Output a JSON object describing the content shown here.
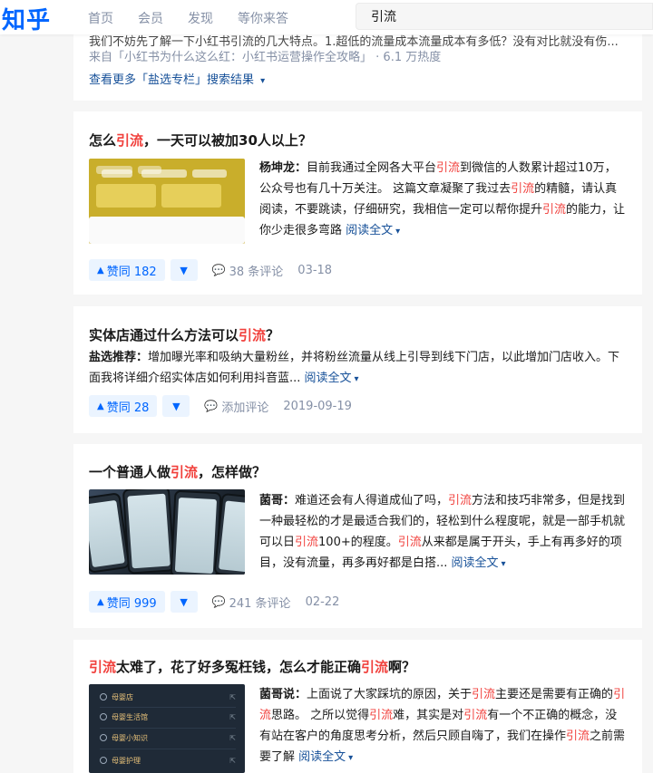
{
  "header": {
    "logo": "知乎",
    "nav": [
      "首页",
      "会员",
      "发现",
      "等你来答"
    ],
    "search_value": "引流"
  },
  "colors": {
    "brand": "#0066ff",
    "highlight": "#f1403c",
    "link": "#175199",
    "meta": "#8590a6"
  },
  "top_card": {
    "snippet": "我们不妨先了解一下小红书引流的几大特点。1.超低的流量成本流量成本有多低？没有对比就没有伤...",
    "source_prefix": "来自「小红书为什么这么红：小红书运营操作全攻略」",
    "source_heat": "· 6.1 万热度",
    "more": "查看更多「盐选专栏」搜索结果"
  },
  "results": [
    {
      "title": [
        "怎么",
        "引流",
        "，一天可以被加30人以上？"
      ],
      "author": "杨坤龙：",
      "excerpt": [
        "目前我通过全网各大平台",
        "引流",
        "到微信的人数累计超过10万，公众号也有几十万关注。 这篇文章凝聚了我过去",
        "引流",
        "的精髓，请认真阅读，不要跳读，仔细研究，我相信一定可以帮你提升",
        "引流",
        "的能力，让你少走很多弯路 "
      ],
      "read_more": "阅读全文",
      "votes": "赞同 182",
      "comments": "38 条评论",
      "date": "03-18",
      "thumb_icons": [
        "thumb-app-screenshot"
      ]
    },
    {
      "title": [
        "实体店通过什么方法可以",
        "引流",
        "？"
      ],
      "author": "盐选推荐：",
      "excerpt": [
        "增加曝光率和吸纳大量粉丝，并将粉丝流量从线上引导到线下门店，以此增加门店收入。下面我将详细介绍实体店如何利用抖音蓝... "
      ],
      "read_more": "阅读全文",
      "votes": "赞同 28",
      "comments": "添加评论",
      "date": "2019-09-19"
    },
    {
      "title": [
        "一个普通人做",
        "引流",
        "，怎样做？"
      ],
      "author": "菌哥：",
      "excerpt": [
        "难道还会有人得道成仙了吗，",
        "引流",
        "方法和技巧非常多，但是找到一种最轻松的才是最适合我们的，轻松到什么程度呢，就是一部手机就可以日",
        "引流",
        "100+的程度。",
        "引流",
        "从来都是属于开头，手上有再多好的项目，没有流量，再多再好都是白搭... "
      ],
      "read_more": "阅读全文",
      "votes": "赞同 999",
      "comments": "241 条评论",
      "date": "02-22"
    },
    {
      "title": [
        "",
        "引流",
        "太难了，花了好多冤枉钱，怎么才能正确",
        "引流",
        "啊？"
      ],
      "author": "菌哥说：",
      "excerpt": [
        "上面说了大家踩坑的原因，关于",
        "引流",
        "主要还是需要有正确的",
        "引流",
        "思路。 之所以觉得",
        "引流",
        "难，其实是对",
        "引流",
        "有一个不正确的概念，没有站在客户的角度思考分析，然后只顾自嗨了，我们在操作",
        "引流",
        "之前需要了解 "
      ],
      "read_more": "阅读全文",
      "thumb_menu": [
        "母婴店",
        "母婴生活馆",
        "母婴小知识",
        "母婴护理"
      ]
    }
  ]
}
